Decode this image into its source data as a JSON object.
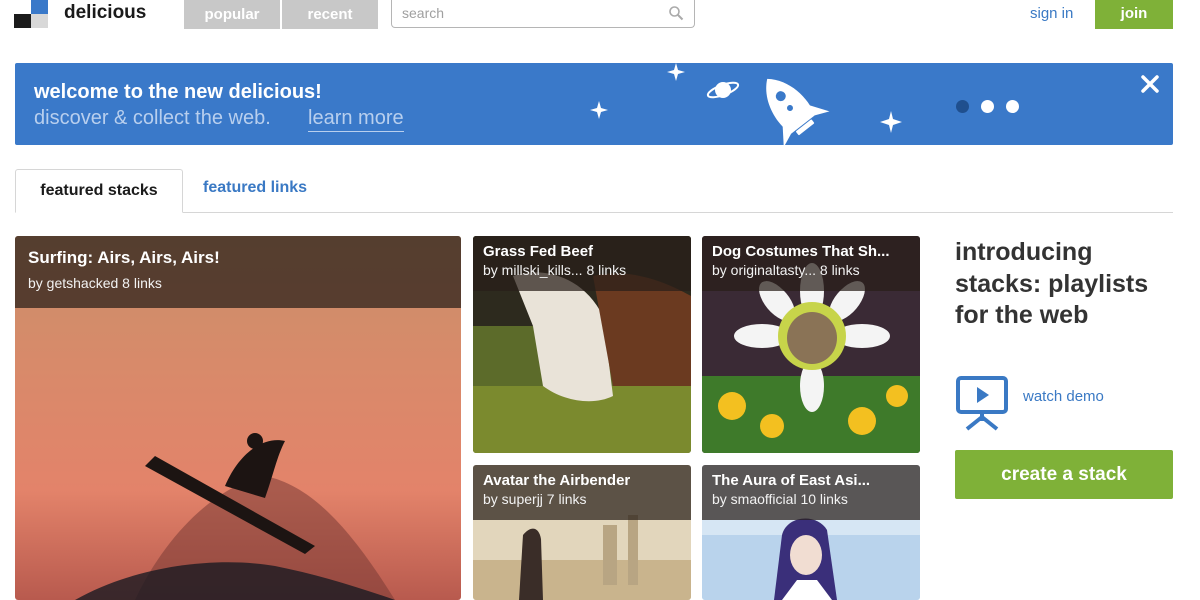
{
  "brand": {
    "name": "delicious"
  },
  "nav": {
    "tabs": [
      "popular",
      "recent"
    ]
  },
  "search": {
    "placeholder": "search"
  },
  "auth": {
    "sign_in": "sign in",
    "join": "join"
  },
  "banner": {
    "title": "welcome to the new delicious!",
    "subtitle": "discover & collect the web.",
    "link": "learn more",
    "close_icon": "close-icon",
    "carousel_dots": 3,
    "active_dot": 1
  },
  "tabs": {
    "active": "featured stacks",
    "other": "featured links"
  },
  "stacks": [
    {
      "title": "Surfing: Airs, Airs, Airs!",
      "meta": "by getshacked 8 links"
    },
    {
      "title": "Grass Fed Beef",
      "meta": "by millski_kills... 8 links"
    },
    {
      "title": "Dog Costumes That Sh...",
      "meta": "by originaltasty... 8 links"
    },
    {
      "title": "Avatar the Airbender",
      "meta": "by superjj 7 links"
    },
    {
      "title": "The Aura of East Asi...",
      "meta": "by smaofficial 10 links"
    }
  ],
  "sidebar": {
    "intro": "introducing stacks: playlists for the web",
    "watch_demo": "watch demo",
    "create_button": "create a stack"
  },
  "colors": {
    "accent_blue": "#3a79c9",
    "link_blue": "#3a79c4",
    "green": "#7fb138",
    "tab_gray": "#c8c8c8"
  }
}
